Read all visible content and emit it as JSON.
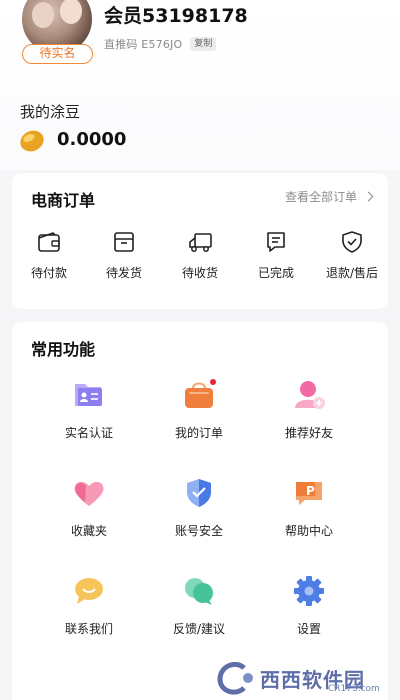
{
  "profile": {
    "verify_badge": "待实名",
    "member_name": "会员53198178",
    "referral_code": "直推码 E576JO",
    "copy_label": "复制",
    "beans_label": "我的涂豆",
    "beans_value": "0.0000"
  },
  "orders": {
    "title": "电商订单",
    "view_all": "查看全部订单",
    "items": [
      {
        "label": "待付款",
        "icon": "wallet-icon"
      },
      {
        "label": "待发货",
        "icon": "box-icon"
      },
      {
        "label": "待收货",
        "icon": "truck-icon"
      },
      {
        "label": "已完成",
        "icon": "document-icon"
      },
      {
        "label": "退款/售后",
        "icon": "shield-icon"
      }
    ]
  },
  "functions": {
    "title": "常用功能",
    "items": [
      {
        "label": "实名认证",
        "icon": "id-card-icon",
        "color": "#8e7ff0"
      },
      {
        "label": "我的订单",
        "icon": "shopping-bag-icon",
        "color": "#f07f3e"
      },
      {
        "label": "推荐好友",
        "icon": "add-user-icon",
        "color": "#f06a9a"
      },
      {
        "label": "收藏夹",
        "icon": "heart-icon",
        "color": "#f07fa0"
      },
      {
        "label": "账号安全",
        "icon": "security-shield-icon",
        "color": "#4a79e6"
      },
      {
        "label": "帮助中心",
        "icon": "help-icon",
        "color": "#f08b45"
      },
      {
        "label": "联系我们",
        "icon": "chat-icon",
        "color": "#f5b944"
      },
      {
        "label": "反馈/建议",
        "icon": "feedback-icon",
        "color": "#45c49a"
      },
      {
        "label": "设置",
        "icon": "gear-icon",
        "color": "#4e7de6"
      }
    ]
  },
  "watermark": {
    "brand": "西西软件园",
    "domain": "CR173.com"
  }
}
